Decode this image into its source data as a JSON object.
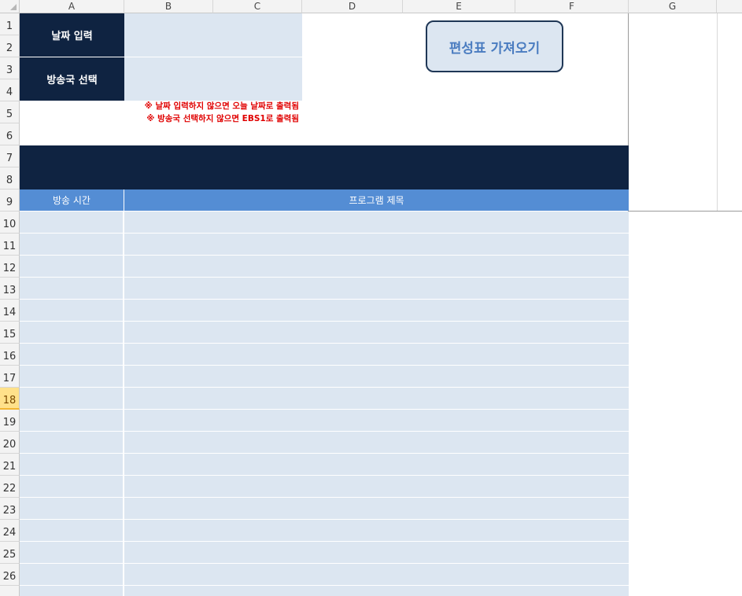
{
  "columns": [
    "A",
    "B",
    "C",
    "D",
    "E",
    "F",
    "G"
  ],
  "rows": [
    "1",
    "2",
    "3",
    "4",
    "5",
    "6",
    "7",
    "8",
    "9",
    "10",
    "11",
    "12",
    "13",
    "14",
    "15",
    "16",
    "17",
    "18",
    "19",
    "20",
    "21",
    "22",
    "23",
    "24",
    "25",
    "26"
  ],
  "selected_row": "18",
  "form": {
    "date_label": "날짜 입력",
    "date_value": "",
    "station_label": "방송국 선택",
    "station_value": "",
    "note_1": "※ 날짜 입력하지 않으면 오늘 날짜로 출력됨",
    "note_2": "※ 방송국 선택하지 않으면 EBS1로 출력됨"
  },
  "fetch_button": {
    "label": "편성표 가져오기"
  },
  "table": {
    "time_header": "방송 시간",
    "title_header": "프로그램 제목"
  },
  "colors": {
    "navy": "#0f2341",
    "input_fill": "#dce6f1",
    "header_blue": "#548dd4",
    "note_red": "#e00000",
    "button_text": "#4a7cc0"
  }
}
